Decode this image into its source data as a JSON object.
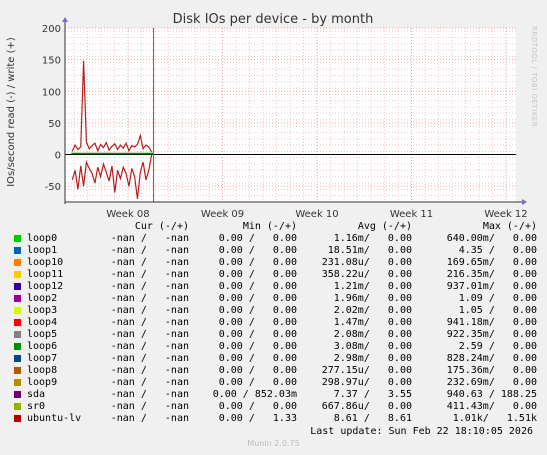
{
  "chart_data": {
    "type": "line",
    "title": "Disk IOs per device - by month",
    "ylabel": "IOs/second read (-) / write (+)",
    "ylim": [
      -75,
      200
    ],
    "yticks": [
      -50,
      0,
      50,
      100,
      150,
      200
    ],
    "x_ticks": [
      "Week 08",
      "Week 09",
      "Week 10",
      "Week 11",
      "Week 12"
    ],
    "grid": true,
    "now_marker_week": 8.27,
    "series": [
      {
        "name": "ubuntu-lv",
        "color": "#b41e1e",
        "x_weeks": [
          7.41,
          7.44,
          7.47,
          7.5,
          7.53,
          7.56,
          7.59,
          7.62,
          7.65,
          7.68,
          7.71,
          7.74,
          7.77,
          7.8,
          7.83,
          7.86,
          7.89,
          7.92,
          7.95,
          7.98,
          8.01,
          8.04,
          8.07,
          8.1,
          8.13,
          8.16,
          8.19,
          8.22,
          8.25
        ],
        "write": [
          5,
          15,
          8,
          12,
          148,
          20,
          9,
          14,
          18,
          6,
          16,
          11,
          19,
          7,
          13,
          17,
          8,
          15,
          10,
          18,
          6,
          14,
          12,
          16,
          30,
          9,
          15,
          12,
          4
        ],
        "read": [
          -40,
          -25,
          -55,
          -18,
          -50,
          -12,
          -22,
          -30,
          -45,
          -20,
          -35,
          -15,
          -28,
          -42,
          -18,
          -60,
          -25,
          -38,
          -20,
          -30,
          -50,
          -22,
          -35,
          -70,
          -28,
          -12,
          -40,
          -25,
          0
        ]
      }
    ]
  },
  "table": {
    "headers": {
      "cur": "Cur (-/+)",
      "min": "Min (-/+)",
      "avg": "Avg (-/+)",
      "max": "Max (-/+)"
    },
    "rows": [
      {
        "name": "loop0",
        "color": "#00cc00",
        "cur": "-nan /   -nan",
        "min": "0.00 /   0.00",
        "avg": "1.16m/   0.00",
        "max": "640.00m/   0.00"
      },
      {
        "name": "loop1",
        "color": "#0066b3",
        "cur": "-nan /   -nan",
        "min": "0.00 /   0.00",
        "avg": "18.51m/   0.00",
        "max": "4.35 /   0.00"
      },
      {
        "name": "loop10",
        "color": "#ff8000",
        "cur": "-nan /   -nan",
        "min": "0.00 /   0.00",
        "avg": "231.08u/   0.00",
        "max": "169.65m/   0.00"
      },
      {
        "name": "loop11",
        "color": "#ffcc00",
        "cur": "-nan /   -nan",
        "min": "0.00 /   0.00",
        "avg": "358.22u/   0.00",
        "max": "216.35m/   0.00"
      },
      {
        "name": "loop12",
        "color": "#330099",
        "cur": "-nan /   -nan",
        "min": "0.00 /   0.00",
        "avg": "1.21m/   0.00",
        "max": "937.01m/   0.00"
      },
      {
        "name": "loop2",
        "color": "#990099",
        "cur": "-nan /   -nan",
        "min": "0.00 /   0.00",
        "avg": "1.96m/   0.00",
        "max": "1.09 /   0.00"
      },
      {
        "name": "loop3",
        "color": "#ccff00",
        "cur": "-nan /   -nan",
        "min": "0.00 /   0.00",
        "avg": "2.02m/   0.00",
        "max": "1.05 /   0.00"
      },
      {
        "name": "loop4",
        "color": "#ff0000",
        "cur": "-nan /   -nan",
        "min": "0.00 /   0.00",
        "avg": "1.47m/   0.00",
        "max": "941.18m/   0.00"
      },
      {
        "name": "loop5",
        "color": "#808080",
        "cur": "-nan /   -nan",
        "min": "0.00 /   0.00",
        "avg": "2.08m/   0.00",
        "max": "922.35m/   0.00"
      },
      {
        "name": "loop6",
        "color": "#008f00",
        "cur": "-nan /   -nan",
        "min": "0.00 /   0.00",
        "avg": "3.08m/   0.00",
        "max": "2.59 /   0.00"
      },
      {
        "name": "loop7",
        "color": "#00487d",
        "cur": "-nan /   -nan",
        "min": "0.00 /   0.00",
        "avg": "2.98m/   0.00",
        "max": "828.24m/   0.00"
      },
      {
        "name": "loop8",
        "color": "#b35a00",
        "cur": "-nan /   -nan",
        "min": "0.00 /   0.00",
        "avg": "277.15u/   0.00",
        "max": "175.36m/   0.00"
      },
      {
        "name": "loop9",
        "color": "#b38f00",
        "cur": "-nan /   -nan",
        "min": "0.00 /   0.00",
        "avg": "298.97u/   0.00",
        "max": "232.69m/   0.00"
      },
      {
        "name": "sda",
        "color": "#6b006b",
        "cur": "-nan /   -nan",
        "min": "0.00 / 852.03m",
        "avg": "7.37 /   3.55",
        "max": "940.63 / 188.25"
      },
      {
        "name": "sr0",
        "color": "#8fb300",
        "cur": "-nan /   -nan",
        "min": "0.00 /   0.00",
        "avg": "667.86u/   0.00",
        "max": "411.43m/   0.00"
      },
      {
        "name": "ubuntu-lv",
        "color": "#b30000",
        "cur": "-nan /   -nan",
        "min": "0.00 /   1.33",
        "avg": "8.61 /   8.61",
        "max": "1.01k/   1.51k"
      }
    ]
  },
  "footer": {
    "last_update": "Last update: Sun Feb 22 18:10:05 2026",
    "munin_version": "Munin 2.0.75",
    "side_label": "RRDTOOL / TOBI OETIKER"
  }
}
